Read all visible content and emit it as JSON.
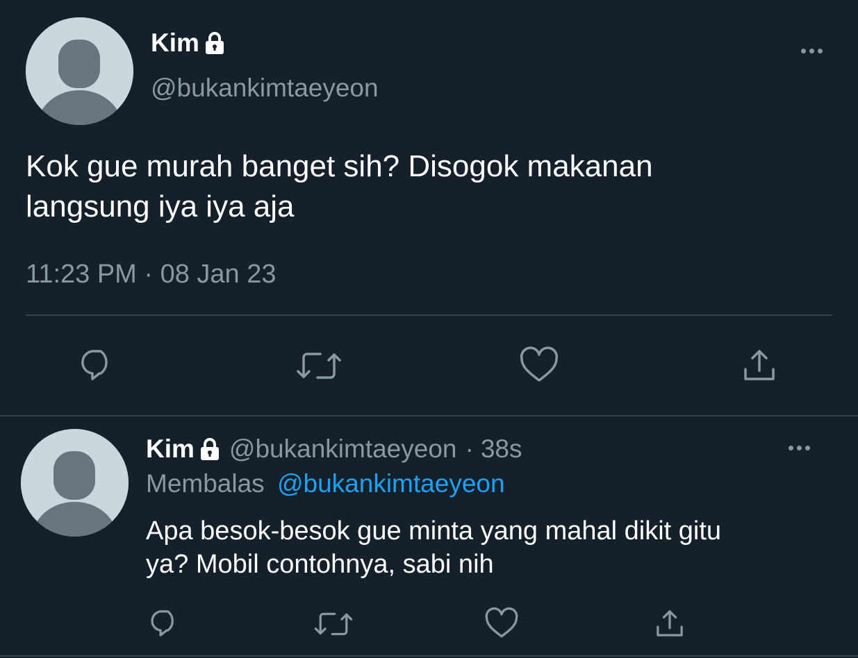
{
  "main_tweet": {
    "display_name": "Kim",
    "handle": "@bukankimtaeyeon",
    "text_line1": "Kok gue murah banget sih? Disogok makanan",
    "text_line2": "langsung iya iya aja",
    "timestamp": "11:23 PM · 08 Jan 23",
    "icons": [
      "reply-icon",
      "retweet-icon",
      "like-icon",
      "share-icon"
    ]
  },
  "reply_tweet": {
    "display_name": "Kim",
    "handle": "@bukankimtaeyeon",
    "dot": "·",
    "time_ago": "38s",
    "replying_label": "Membalas",
    "replying_to": "@bukankimtaeyeon",
    "text_line1": "Apa besok-besok gue minta yang mahal dikit gitu",
    "text_line2": "ya? Mobil contohnya, sabi nih",
    "icons": [
      "reply-icon",
      "retweet-icon",
      "like-icon",
      "share-icon"
    ]
  },
  "colors": {
    "background": "#15202b",
    "text": "#ffffff",
    "muted": "#8899a6",
    "link": "#1da1f2",
    "divider": "#38444d",
    "avatar_bg": "#ccd6dd",
    "avatar_fg": "#66757f"
  }
}
